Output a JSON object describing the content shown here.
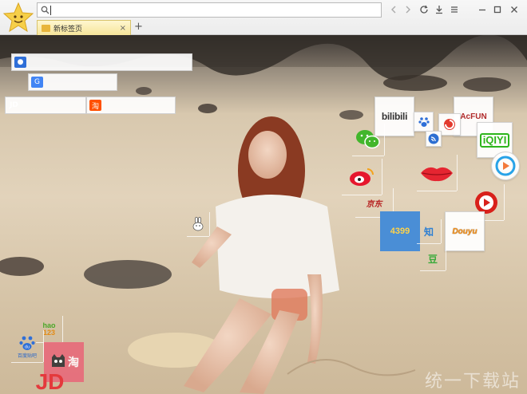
{
  "browser": {
    "logo_icon": "smiley-star-icon",
    "address": {
      "value": "",
      "placeholder": ""
    },
    "toolbar": [
      "back-icon",
      "forward-icon",
      "refresh-icon",
      "download-icon",
      "menu-icon",
      "minimize-icon",
      "maximize-icon",
      "close-icon"
    ],
    "tabs": [
      {
        "label": "新标签页",
        "close": "×"
      }
    ],
    "new_tab_label": "+"
  },
  "search_bars": [
    {
      "engine": "baidu",
      "icon": "baidu-paw-icon",
      "value": ""
    },
    {
      "engine": "google",
      "icon": "google-icon",
      "label": "G",
      "value": ""
    },
    {
      "engine": "jd",
      "label": "JD",
      "value": ""
    },
    {
      "engine": "taobao",
      "icon": "taobao-icon",
      "label": "淘",
      "value": ""
    }
  ],
  "tiles": {
    "bilibili": "bilibili",
    "acfun": "AcFUN",
    "iqiyi": "iQIYI",
    "4399": "4399",
    "zhihu": "知",
    "douban": "豆",
    "douyu": "Douyu",
    "hao123_top": "hao",
    "hao123_bottom": "123",
    "baidu_tieba": "百度贴吧",
    "jingdong": "京东",
    "tmall": "淘",
    "jd_big": "JD",
    "du": "du"
  },
  "watermark": "统一下载站",
  "colors": {
    "tab_bg": "#f6e59a",
    "weibo_red": "#e6162d",
    "wechat_green": "#42b62b",
    "blue_4399": "#4a8ed6",
    "tmall_pink": "#e86a7a"
  }
}
